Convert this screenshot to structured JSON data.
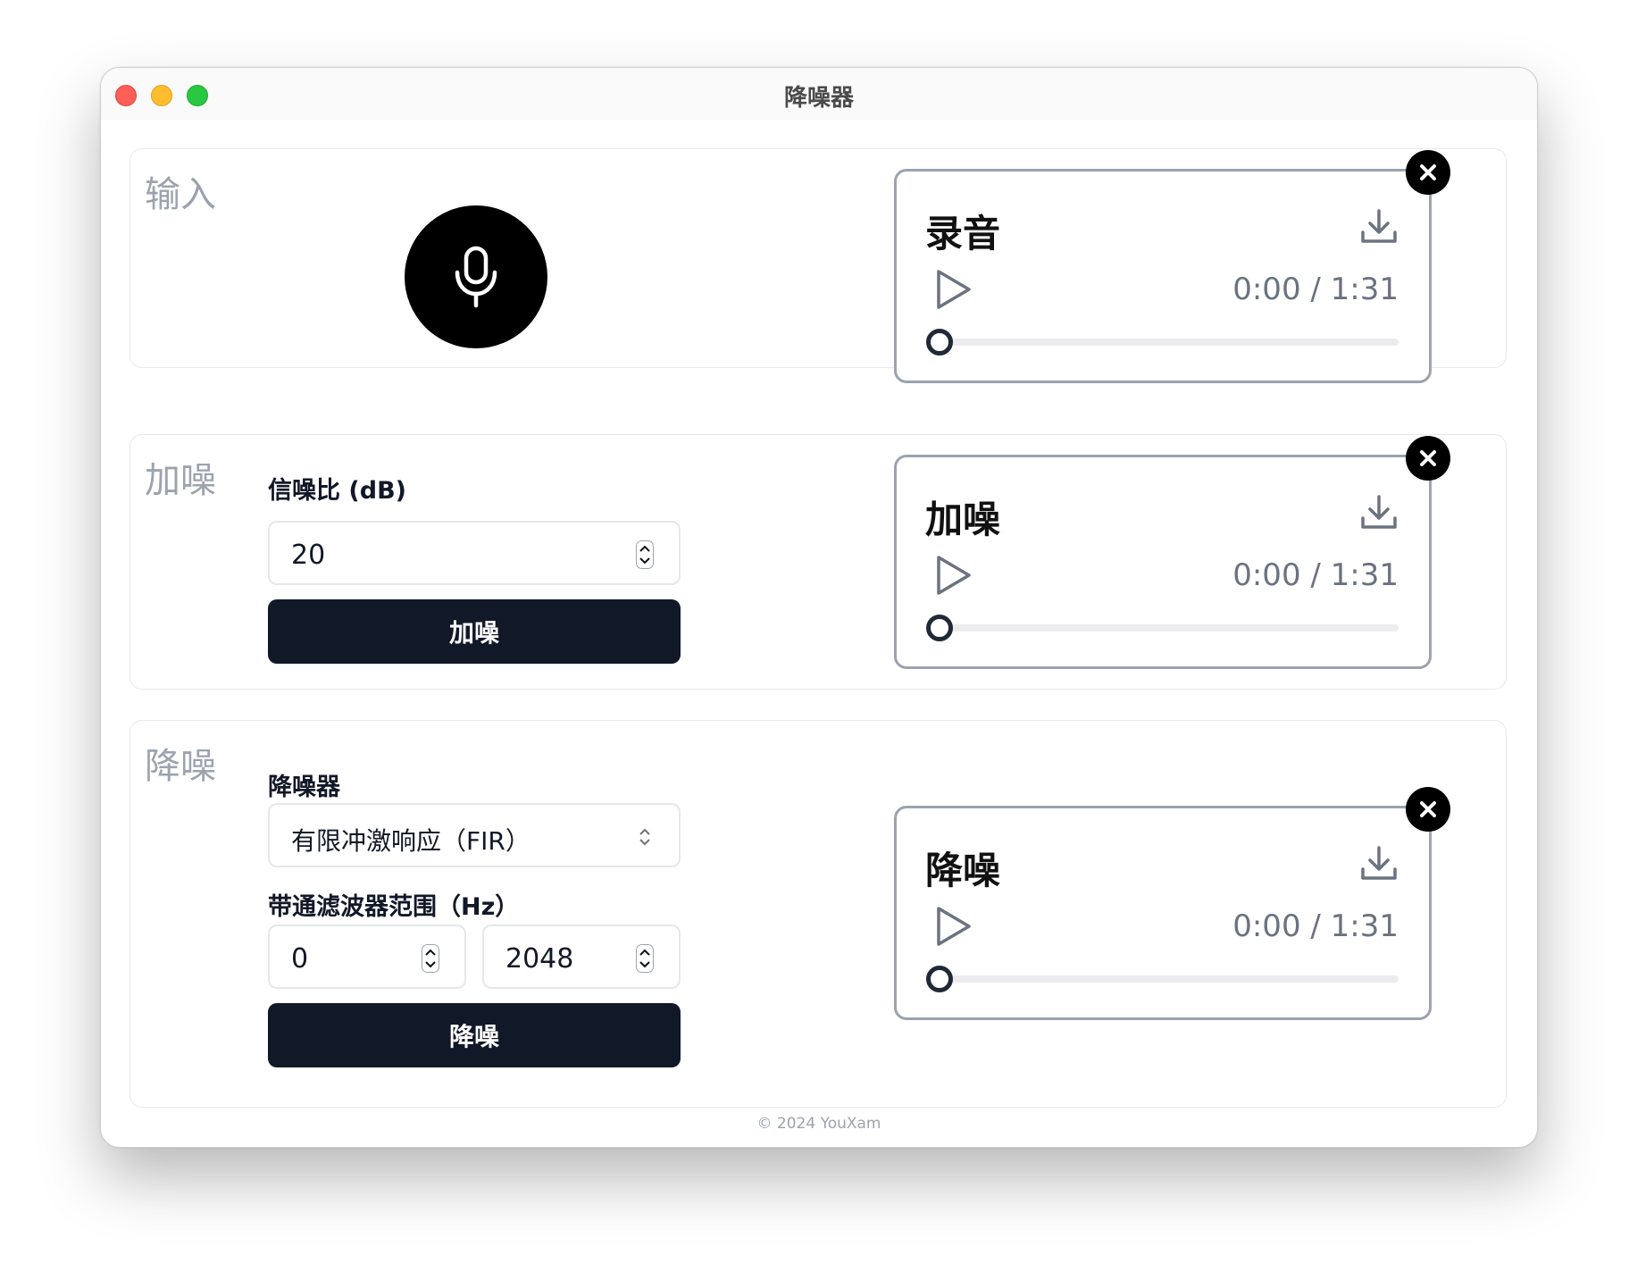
{
  "window": {
    "title": "降噪器"
  },
  "input_section": {
    "label": "输入",
    "player": {
      "title": "录音",
      "time": "0:00 / 1:31",
      "progress": 0
    }
  },
  "add_noise_section": {
    "label": "加噪",
    "snr_label": "信噪比 (dB)",
    "snr_value": "20",
    "button_label": "加噪",
    "player": {
      "title": "加噪",
      "time": "0:00 / 1:31",
      "progress": 0
    }
  },
  "denoise_section": {
    "label": "降噪",
    "denoiser_label": "降噪器",
    "denoiser_selected": "有限冲激响应（FIR）",
    "bandpass_label": "带通滤波器范围（Hz）",
    "bandpass_low": "0",
    "bandpass_high": "2048",
    "button_label": "降噪",
    "player": {
      "title": "降噪",
      "time": "0:00 / 1:31",
      "progress": 0
    }
  },
  "footer": {
    "text": "© 2024 YouXam"
  },
  "colors": {
    "primary_button": "#111827",
    "section_label": "#9ca3af",
    "player_border": "#9ca3af",
    "traffic_red": "#fe5f57",
    "traffic_yellow": "#febc2e",
    "traffic_green": "#28c840"
  },
  "icons": [
    "microphone-icon",
    "download-icon",
    "play-icon",
    "close-icon",
    "spinner-icon",
    "chevron-updown-icon"
  ]
}
